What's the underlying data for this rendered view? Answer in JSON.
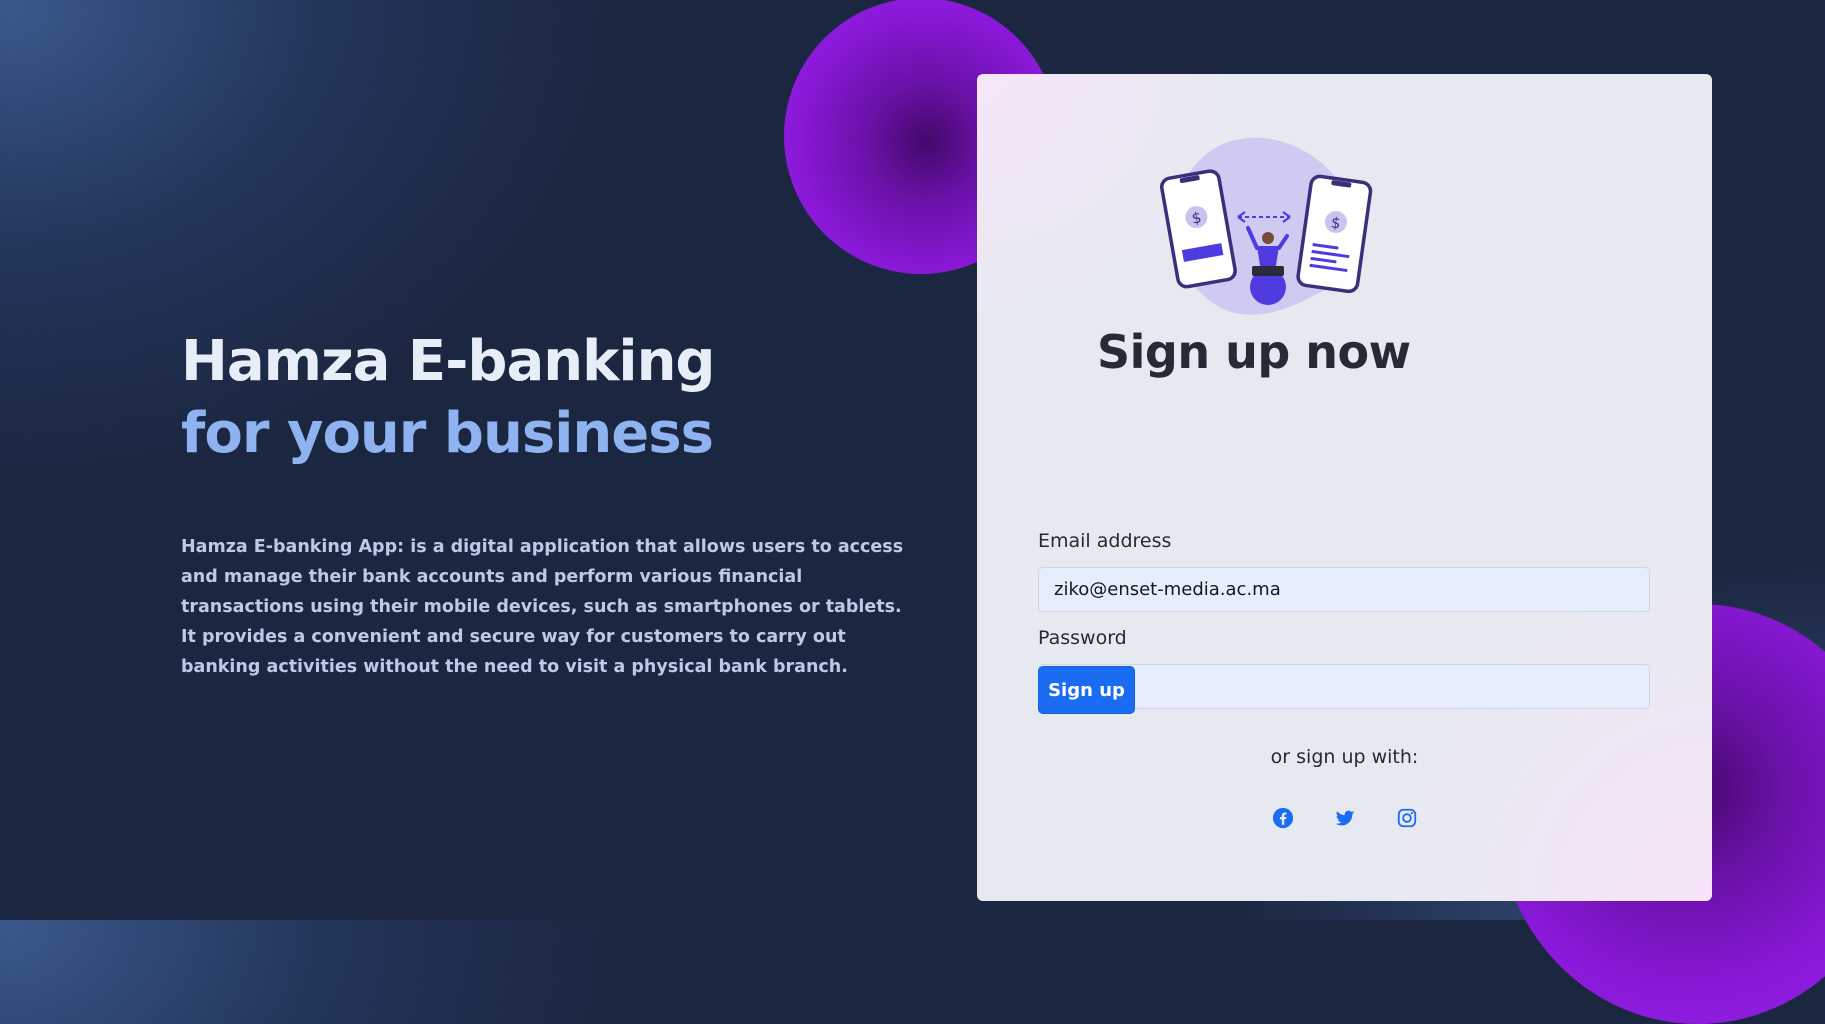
{
  "hero": {
    "title_line1": "Hamza E-banking",
    "title_line2": "for your business",
    "description": "Hamza E-banking App: is a digital application that allows users to access and manage their bank accounts and perform various financial transactions using their mobile devices, such as smartphones or tablets. It provides a convenient and secure way for customers to carry out banking activities without the need to visit a physical bank branch."
  },
  "signup": {
    "heading": "Sign up now",
    "email_label": "Email address",
    "email_value": "ziko@enset-media.ac.ma",
    "password_label": "Password",
    "password_value": "•••••••",
    "submit_label": "Sign up",
    "alt_text": "or sign up with:",
    "social_icons": [
      "facebook-icon",
      "twitter-icon",
      "instagram-icon"
    ]
  },
  "colors": {
    "accent": "#1a6cf2",
    "blob": "#8a18d8",
    "title_accent": "#8fb2f0"
  }
}
